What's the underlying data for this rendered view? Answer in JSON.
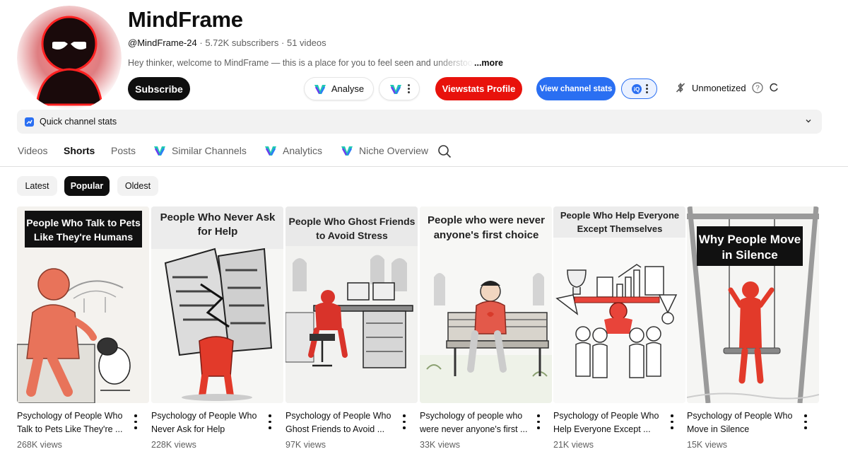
{
  "channel": {
    "name": "MindFrame",
    "handle": "@MindFrame-24",
    "subscribers": "5.72K subscribers",
    "videos": "51 videos",
    "separator": "·",
    "description": "Hey thinker, welcome to MindFrame — this is a place for you to feel seen and understood.",
    "more_label": "...more"
  },
  "actions": {
    "subscribe": "Subscribe",
    "analyse": "Analyse",
    "viewstats_profile": "Viewstats Profile",
    "view_channel_stats": "View channel stats",
    "monetization": "Unmonetized"
  },
  "quick_stats": {
    "label": "Quick channel stats"
  },
  "tabs": [
    {
      "label": "Videos"
    },
    {
      "label": "Shorts",
      "active": true
    },
    {
      "label": "Posts"
    },
    {
      "label": "Similar Channels"
    },
    {
      "label": "Analytics"
    },
    {
      "label": "Niche Overview"
    }
  ],
  "filters": [
    {
      "label": "Latest"
    },
    {
      "label": "Popular",
      "active": true
    },
    {
      "label": "Oldest"
    }
  ],
  "shorts": [
    {
      "thumb_caption": [
        "People Who Talk to Pets",
        "Like They're Humans"
      ],
      "title_line1": "Psychology of People Who",
      "title_line2": "Talk to Pets Like They're ...",
      "views": "268K views"
    },
    {
      "thumb_caption": [
        "People Who Never Ask",
        "for Help"
      ],
      "title_line1": "Psychology of People Who",
      "title_line2": "Never Ask for Help",
      "views": "228K views"
    },
    {
      "thumb_caption": [
        "People Who Ghost Friends",
        "to Avoid Stress"
      ],
      "title_line1": "Psychology of People Who",
      "title_line2": "Ghost Friends to Avoid ...",
      "views": "97K views"
    },
    {
      "thumb_caption": [
        "People who were never",
        "anyone's first choice"
      ],
      "title_line1": "Psychology of people who",
      "title_line2": "were never anyone's first ...",
      "views": "33K views"
    },
    {
      "thumb_caption": [
        "People Who Help Everyone",
        "Except Themselves"
      ],
      "title_line1": "Psychology of People Who",
      "title_line2": "Help Everyone Except ...",
      "views": "21K views"
    },
    {
      "thumb_caption": [
        "Why People  Move",
        "in Silence"
      ],
      "title_line1": "Psychology of People Who",
      "title_line2": "Move in Silence",
      "views": "15K views"
    }
  ],
  "colors": {
    "figure_red": "#e8443a",
    "viewstats_red": "#e8120c",
    "stats_blue": "#2a6ff2",
    "text_primary": "#0f0f0f",
    "text_secondary": "#606060"
  }
}
